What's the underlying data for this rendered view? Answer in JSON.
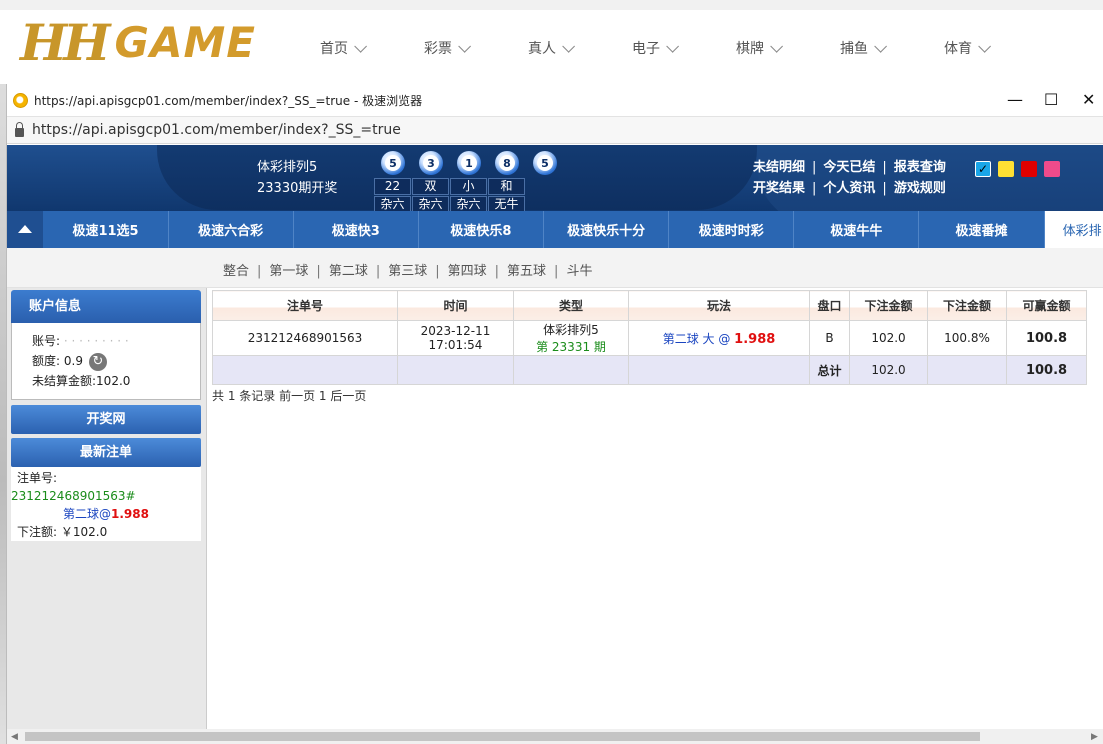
{
  "site": {
    "logo_prefix": "HH",
    "logo_text": "GAME",
    "nav": [
      "首页",
      "彩票",
      "真人",
      "电子",
      "棋牌",
      "捕鱼",
      "体育"
    ]
  },
  "browser": {
    "title": "https://api.apisgcp01.com/member/index?_SS_=true - 极速浏览器",
    "address": "https://api.apisgcp01.com/member/index?_SS_=true",
    "min_label": "—",
    "max_label": "☐",
    "close_label": "✕"
  },
  "lottery": {
    "game_name": "体彩排列5",
    "period_open": "23330期开奖",
    "balls": [
      "5",
      "3",
      "1",
      "8",
      "5"
    ],
    "stats_row1": [
      "22",
      "双",
      "小",
      "和"
    ],
    "stats_row2": [
      "杂六",
      "杂六",
      "杂六",
      "无牛"
    ],
    "links_row1": [
      "未结明细",
      "今天已结",
      "报表查询"
    ],
    "links_row2": [
      "开奖结果",
      "个人资讯",
      "游戏规则"
    ],
    "separator": "|",
    "theme_colors": [
      "#1aa6e8",
      "#ffe033",
      "#e00000",
      "#ef4b8b"
    ],
    "check_mark": "✓"
  },
  "tabs": [
    "极速11选5",
    "极速六合彩",
    "极速快3",
    "极速快乐8",
    "极速快乐十分",
    "极速时时彩",
    "极速牛牛",
    "极速番摊",
    "体彩排"
  ],
  "subnav": {
    "items": [
      "整合",
      "第一球",
      "第二球",
      "第三球",
      "第四球",
      "第五球",
      "斗牛"
    ],
    "separator": "|"
  },
  "account": {
    "header": "账户信息",
    "account_label": "账号:",
    "account_value": "· · · · · · · · ·",
    "quota_label": "额度:",
    "quota_value": "0.9",
    "refresh_glyph": "↻",
    "unsettled_label": "未结算金额:",
    "unsettled_value": "102.0"
  },
  "buttons": {
    "draw_site": "开奖网",
    "latest_bets": "最新注单"
  },
  "latest": {
    "order_label": "注单号:",
    "order_no": "231212468901563#",
    "play": "第二球@",
    "odds": "1.988",
    "amount_label": "下注额:",
    "amount_value": "￥102.0"
  },
  "table": {
    "headers": [
      "注单号",
      "时间",
      "类型",
      "玩法",
      "盘口",
      "下注金额",
      "下注金额",
      "可赢金额"
    ],
    "row": {
      "order_no": "231212468901563",
      "date": "2023-12-11",
      "time": "17:01:54",
      "type": "体彩排列5",
      "period": "第 23331 期",
      "play": "第二球 大 @",
      "odds": "1.988",
      "market": "B",
      "amount": "102.0",
      "rebate": "100.8%",
      "win": "100.8"
    },
    "total": {
      "label": "总计",
      "amount": "102.0",
      "win": "100.8"
    }
  },
  "pager": "共 1 条记录 前一页 1 后一页"
}
